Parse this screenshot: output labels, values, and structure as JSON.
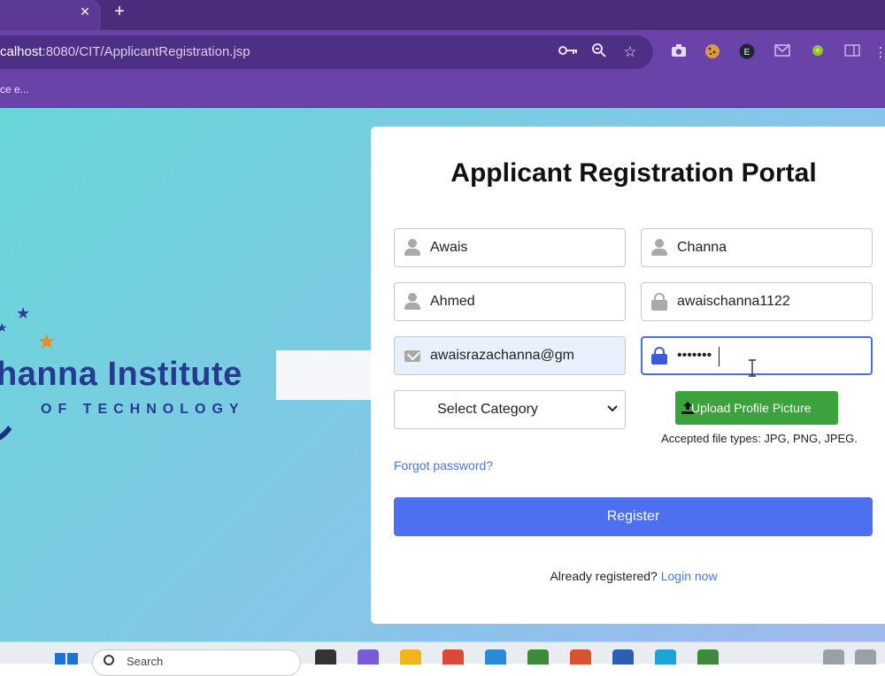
{
  "browser": {
    "tab_close": "×",
    "new_tab": "+",
    "url_host": "calhost",
    "url_rest": ":8080/CIT/ApplicantRegistration.jsp",
    "bookmark": "ce e..."
  },
  "branding": {
    "title": "hanna Institute",
    "subtitle": "OF TECHNOLOGY"
  },
  "form": {
    "title": "Applicant Registration Portal",
    "first_name": "Awais",
    "last_name": "Channa",
    "middle_name": "Ahmed",
    "username": "awaischanna1122",
    "email": "awaisrazachanna@gm",
    "password_mask": "•••••••",
    "category": "Select Category",
    "upload_label": "Upload Profile Picture",
    "accepted_types": "Accepted file types: JPG, PNG, JPEG.",
    "forgot": "Forgot password?",
    "register": "Register",
    "already_text": "Already registered?",
    "login_link": "Login now"
  },
  "taskbar": {
    "search_text": "Search"
  },
  "colors": {
    "primary": "#4c70f0",
    "upload": "#3ba23d",
    "link": "#4a78d6",
    "chrome": "#6a43a8"
  },
  "icons": [
    "key-icon",
    "zoom-icon",
    "star-icon",
    "camera-icon",
    "cookie-icon",
    "extension-e-icon",
    "mail-icon",
    "location-icon",
    "sidebar-icon",
    "menu-dots-icon",
    "person-icon",
    "lock-icon",
    "email-icon",
    "upload-icon",
    "windows-icon",
    "search-icon"
  ]
}
